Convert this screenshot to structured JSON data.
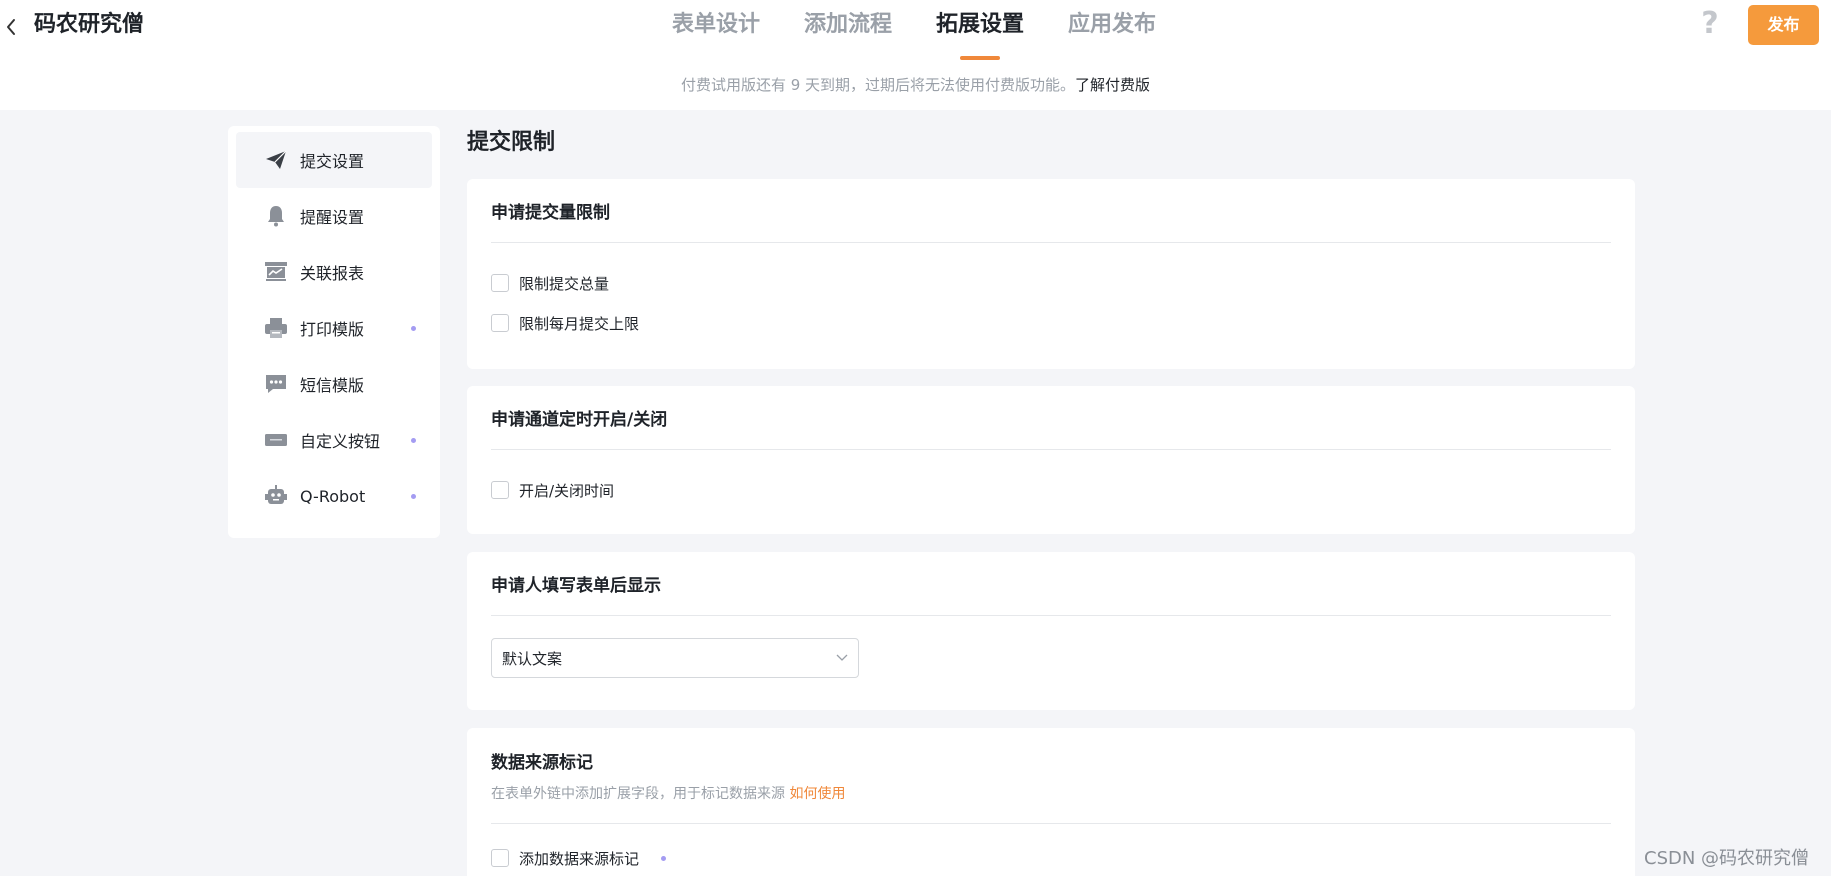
{
  "header": {
    "app_title": "码农研究僧",
    "tabs": [
      {
        "label": "表单设计"
      },
      {
        "label": "添加流程"
      },
      {
        "label": "拓展设置"
      },
      {
        "label": "应用发布"
      }
    ],
    "active_tab": 2,
    "help_glyph": "?",
    "publish_label": "发布"
  },
  "notice": {
    "text": "付费试用版还有 9 天到期，过期后将无法使用付费版功能。",
    "link": "了解付费版"
  },
  "sidebar": {
    "items": [
      {
        "label": "提交设置",
        "icon": "send-icon",
        "active": true,
        "dot": false
      },
      {
        "label": "提醒设置",
        "icon": "bell-icon",
        "active": false,
        "dot": false
      },
      {
        "label": "关联报表",
        "icon": "report-icon",
        "active": false,
        "dot": false
      },
      {
        "label": "打印模版",
        "icon": "printer-icon",
        "active": false,
        "dot": true
      },
      {
        "label": "短信模版",
        "icon": "message-icon",
        "active": false,
        "dot": false
      },
      {
        "label": "自定义按钮",
        "icon": "button-icon",
        "active": false,
        "dot": true
      },
      {
        "label": "Q-Robot",
        "icon": "robot-icon",
        "active": false,
        "dot": true
      }
    ]
  },
  "main": {
    "title": "提交限制",
    "cards": {
      "quota": {
        "title": "申请提交量限制",
        "options": [
          "限制提交总量",
          "限制每月提交上限"
        ]
      },
      "schedule": {
        "title": "申请通道定时开启/关闭",
        "options": [
          "开启/关闭时间"
        ]
      },
      "after_submit": {
        "title": "申请人填写表单后显示",
        "select_value": "默认文案"
      },
      "source": {
        "title": "数据来源标记",
        "desc": "在表单外链中添加扩展字段，用于标记数据来源",
        "desc_link": "如何使用",
        "option": "添加数据来源标记"
      }
    }
  },
  "watermark": "CSDN @码农研究僧",
  "colors": {
    "accent": "#f0883a",
    "publish_button": "#f59a3c",
    "dot": "#a49cf2"
  }
}
